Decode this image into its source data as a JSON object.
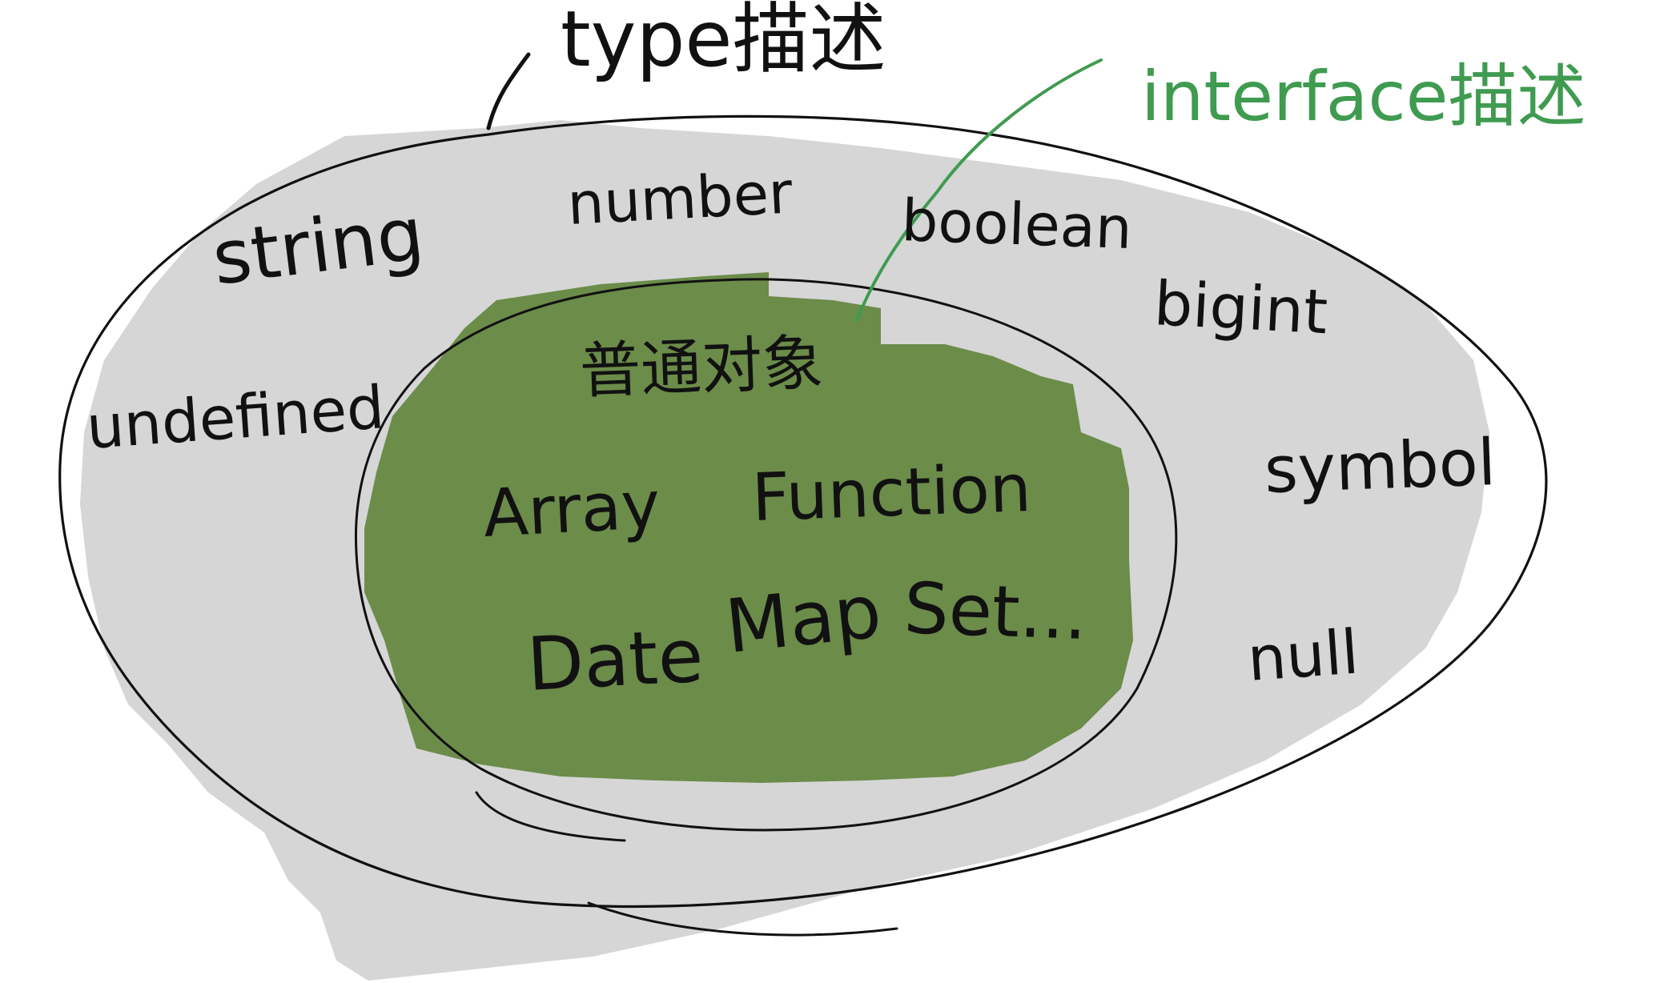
{
  "labels": {
    "type_caption": "type描述",
    "interface_caption": "interface描述"
  },
  "primitives": {
    "string": "string",
    "number": "number",
    "boolean": "boolean",
    "bigint": "bigint",
    "undefined": "undefined",
    "symbol": "symbol",
    "null": "null"
  },
  "objects": {
    "plain_object": "普通对象",
    "array": "Array",
    "function": "Function",
    "date": "Date",
    "map": "Map",
    "set": "Set..."
  },
  "colors": {
    "outer_fill": "#d6d6d6",
    "inner_fill": "#6c8c4a",
    "ink": "#111111",
    "green_ink": "#3f9b50"
  }
}
